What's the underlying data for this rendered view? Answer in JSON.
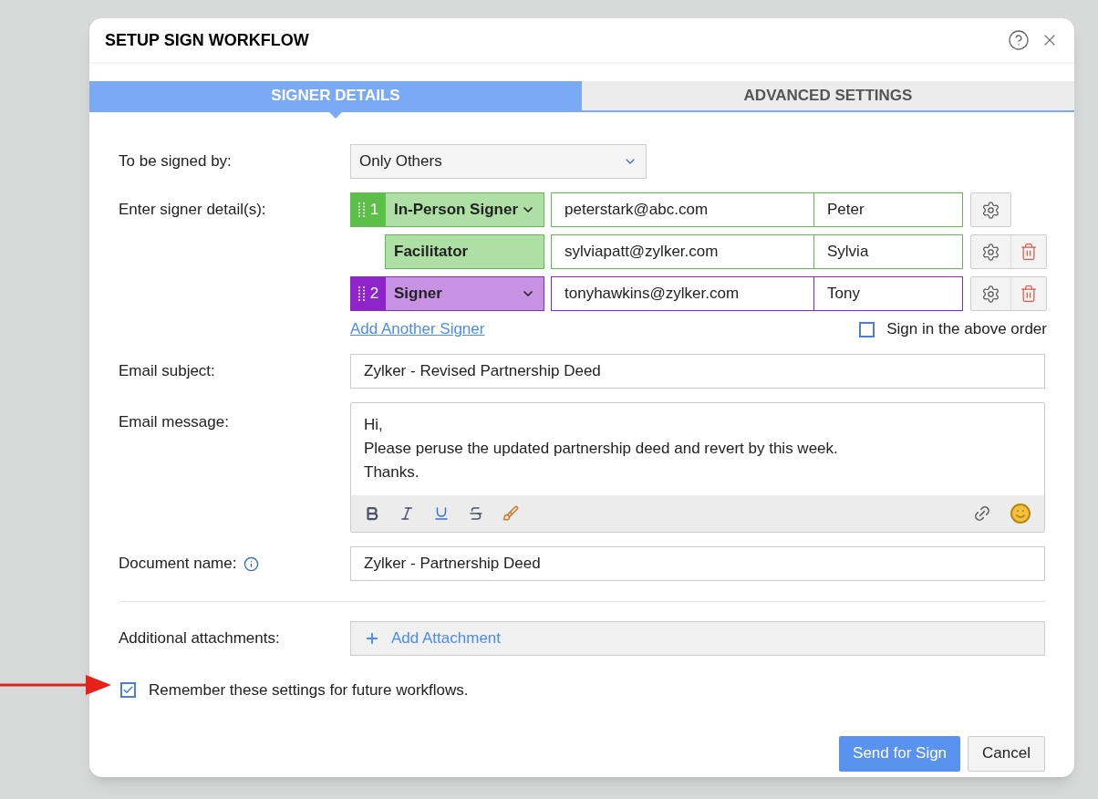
{
  "dialog": {
    "title": "SETUP SIGN WORKFLOW"
  },
  "tabs": [
    {
      "label": "SIGNER DETAILS",
      "selected": true
    },
    {
      "label": "ADVANCED SETTINGS",
      "selected": false
    }
  ],
  "signed_by": {
    "label": "To be signed by:",
    "value": "Only Others"
  },
  "signers": {
    "label": "Enter signer detail(s):",
    "rows": [
      {
        "kind": "signer",
        "number": "1",
        "role": "In-Person Signer",
        "email": "peterstark@abc.com",
        "name": "Peter",
        "color": "#5cbf4a",
        "deletable": false
      },
      {
        "kind": "facilitator",
        "role": "Facilitator",
        "email": "sylviapatt@zylker.com",
        "name": "Sylvia",
        "color": "#5cbf4a",
        "deletable": true
      },
      {
        "kind": "signer",
        "number": "2",
        "role": "Signer",
        "email": "tonyhawkins@zylker.com",
        "name": "Tony",
        "color": "#8e24c9",
        "deletable": true
      }
    ],
    "add_link": "Add Another Signer",
    "order": {
      "label": "Sign in the above order",
      "checked": false
    }
  },
  "email_subject": {
    "label": "Email subject:",
    "value": "Zylker - Revised Partnership Deed"
  },
  "email_message": {
    "label": "Email message:",
    "lines": [
      "Hi,",
      "Please peruse the updated partnership deed and revert by this week.",
      "Thanks."
    ]
  },
  "document_name": {
    "label": "Document name:",
    "value": "Zylker - Partnership Deed"
  },
  "attachments": {
    "label": "Additional attachments:",
    "button": "Add Attachment"
  },
  "remember": {
    "label": "Remember these settings for future workflows.",
    "checked": true
  },
  "buttons": [
    {
      "kind": "primary",
      "label": "Send for Sign"
    },
    {
      "kind": "secondary",
      "label": "Cancel"
    }
  ]
}
